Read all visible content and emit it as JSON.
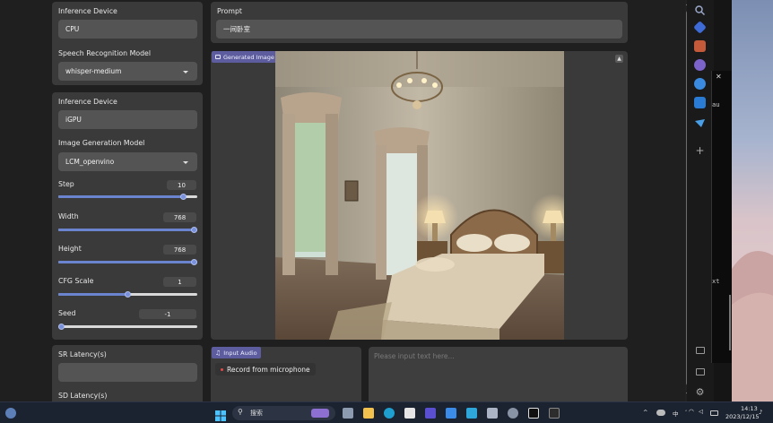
{
  "left_column": {
    "asr_panel": {
      "device_label": "Inference Device",
      "device_value": "CPU",
      "model_label": "Speech Recognition Model",
      "model_value": "whisper-medium"
    },
    "image_panel": {
      "device_label": "Inference Device",
      "device_value": "iGPU",
      "model_label": "Image Generation Model",
      "model_value": "LCM_openvino",
      "step": {
        "label": "Step",
        "value": "10",
        "fraction": 0.9
      },
      "width": {
        "label": "Width",
        "value": "768",
        "fraction": 1.0
      },
      "height": {
        "label": "Height",
        "value": "768",
        "fraction": 1.0
      },
      "cfg": {
        "label": "CFG Scale",
        "value": "1",
        "fraction": 0.5
      },
      "seed": {
        "label": "Seed",
        "value": "-1",
        "fraction": 0.0
      }
    },
    "latency_panel": {
      "sr_label": "SR Latency(s)",
      "sr_value": "",
      "sd_label": "SD Latency(s)"
    }
  },
  "main": {
    "prompt_label": "Prompt",
    "prompt_value": "一间卧室",
    "generated_badge": "Generated Image",
    "input_audio_badge": "Input Audio",
    "record_button": "Record from microphone",
    "text_placeholder": "Please input text here..."
  },
  "terminal": {
    "close_glyph": "✕",
    "lines": [
      "au",
      "xt"
    ]
  },
  "taskbar": {
    "search_label": "搜索",
    "ime_label": "中",
    "time": "14:13",
    "date": "2023/12/15"
  },
  "colors": {
    "panel": "#3a3a3a",
    "input": "#545454",
    "slider_accent": "#6b84cf",
    "badge": "#5c5c9e"
  }
}
